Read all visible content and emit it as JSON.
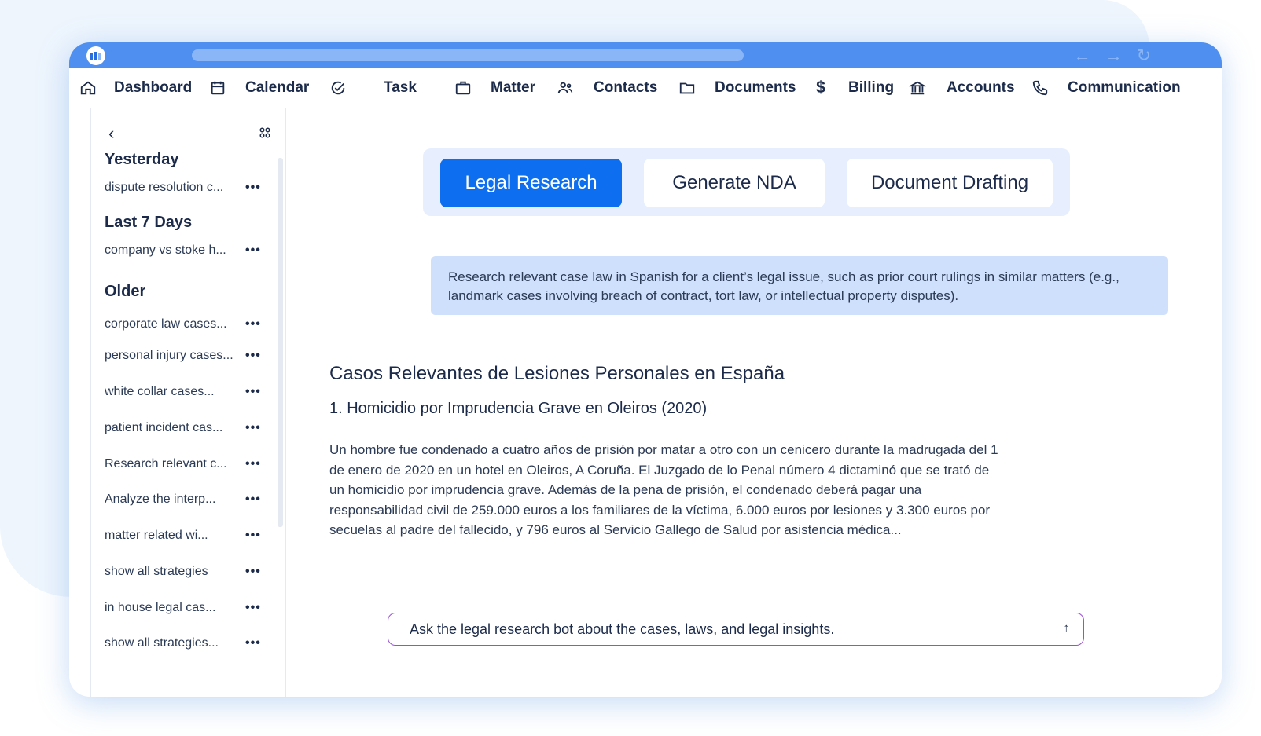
{
  "nav": {
    "items": [
      {
        "label": "Dashboard",
        "icon": "home-icon"
      },
      {
        "label": "Calendar",
        "icon": "calendar-icon"
      },
      {
        "label": "Task",
        "icon": "task-check-icon"
      },
      {
        "label": "Matter",
        "icon": "briefcase-icon"
      },
      {
        "label": "Contacts",
        "icon": "contacts-icon"
      },
      {
        "label": "Documents",
        "icon": "folder-icon"
      },
      {
        "label": "Billing",
        "icon": "dollar-icon"
      },
      {
        "label": "Accounts",
        "icon": "bank-icon"
      },
      {
        "label": "Communication",
        "icon": "phone-icon"
      }
    ]
  },
  "sidebar": {
    "sections": [
      {
        "heading": "Yesterday",
        "items": [
          "dispute resolution c..."
        ]
      },
      {
        "heading": "Last 7 Days",
        "items": [
          "company vs stoke h..."
        ]
      },
      {
        "heading": "Older",
        "items": [
          "corporate law cases...",
          "personal injury cases...",
          "white collar cases...",
          "patient incident cas...",
          "Research relevant c...",
          "Analyze the interp...",
          "matter related wi...",
          "show all strategies",
          "in house legal cas...",
          "show all strategies..."
        ]
      }
    ],
    "more_label": "•••"
  },
  "tabs": [
    {
      "label": "Legal Research",
      "active": true
    },
    {
      "label": "Generate NDA",
      "active": false
    },
    {
      "label": "Document Drafting",
      "active": false
    }
  ],
  "prompt": "Research relevant case law in Spanish for a client’s legal issue, such as prior court rulings in similar matters (e.g., landmark cases involving breach of contract, tort law, or intellectual property disputes).",
  "result": {
    "title": "Casos Relevantes de Lesiones Personales en España",
    "subtitle": "1. Homicidio por Imprudencia Grave en Oleiros (2020)",
    "body": "Un hombre fue condenado a cuatro años de prisión por matar a otro con un cenicero durante la madrugada del 1 de enero de 2020 en un hotel en Oleiros, A Coruña. El Juzgado de lo Penal número 4 dictaminó que se trató de un homicidio por imprudencia grave. Además de la pena de prisión, el condenado deberá pagar una responsabilidad civil de 259.000 euros a los familiares de la víctima, 6.000 euros por lesiones y 3.300 euros por secuelas al padre del fallecido, y 796 euros al Servicio Gallego de Salud por asistencia médica..."
  },
  "ask": {
    "placeholder": "Ask the legal research bot about the cases, laws, and legal insights.",
    "send_icon": "↑"
  },
  "colors": {
    "titlebar": "#4f8ff0",
    "accent": "#0d6ef0",
    "prompt_bg": "#cfe0fc",
    "ask_border": "#9b4fd8"
  }
}
